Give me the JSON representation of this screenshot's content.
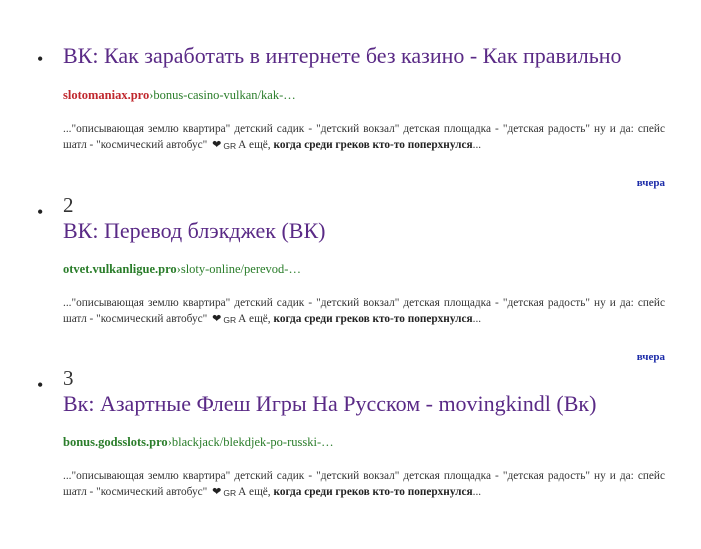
{
  "results": [
    {
      "number": "",
      "title": "ВК: Как заработать в интернете без казино - Как правильно",
      "domain": "slotomaniax.pro",
      "path": "›bonus-casino-vulkan/kak-…",
      "snippet_text": "...\"описывающая землю квартира\" детский садик - \"детский вокзал\" детская площадка - \"детская радость\" ну и да: спейс шатл - \"космический автобус\"",
      "heart": "❤",
      "gr": "GR",
      "snippet_tail": "А ещё,",
      "snippet_bold": "когда среди греков кто-то поперхнулся",
      "snippet_end": "...",
      "date": "вчера"
    },
    {
      "number": "2",
      "title": "ВК: Перевод блэкджек (ВК)",
      "domain": "otvet.vulkanligue.pro",
      "path": "›sloty-online/perevod-…",
      "snippet_text": "...\"описывающая землю квартира\" детский садик - \"детский вокзал\" детская площадка - \"детская радость\" ну и да: спейс шатл - \"космический автобус\"",
      "heart": "❤",
      "gr": "GR",
      "snippet_tail": "А ещё,",
      "snippet_bold": "когда среди греков кто-то поперхнулся",
      "snippet_end": "...",
      "date": "вчера"
    },
    {
      "number": "3",
      "title": "Вк: Азартные Флеш Игры На Русском - movingkindl  (Вк)",
      "domain": "bonus.godsslots.pro",
      "path": "›blackjack/blekdjek-po-russki-…",
      "snippet_text": "...\"описывающая землю квартира\" детский садик - \"детский вокзал\" детская площадка - \"детская радость\" ну и да: спейс шатл - \"космический автобус\"",
      "heart": "❤",
      "gr": "GR",
      "snippet_tail": "А ещё,",
      "snippet_bold": "когда среди греков кто-то поперхнулся",
      "snippet_end": "..."
    }
  ],
  "colors": {
    "title": "#5a2a86",
    "domain_first": "#c0272d",
    "domain": "#2a7d2a",
    "date": "#1a2aa8"
  }
}
